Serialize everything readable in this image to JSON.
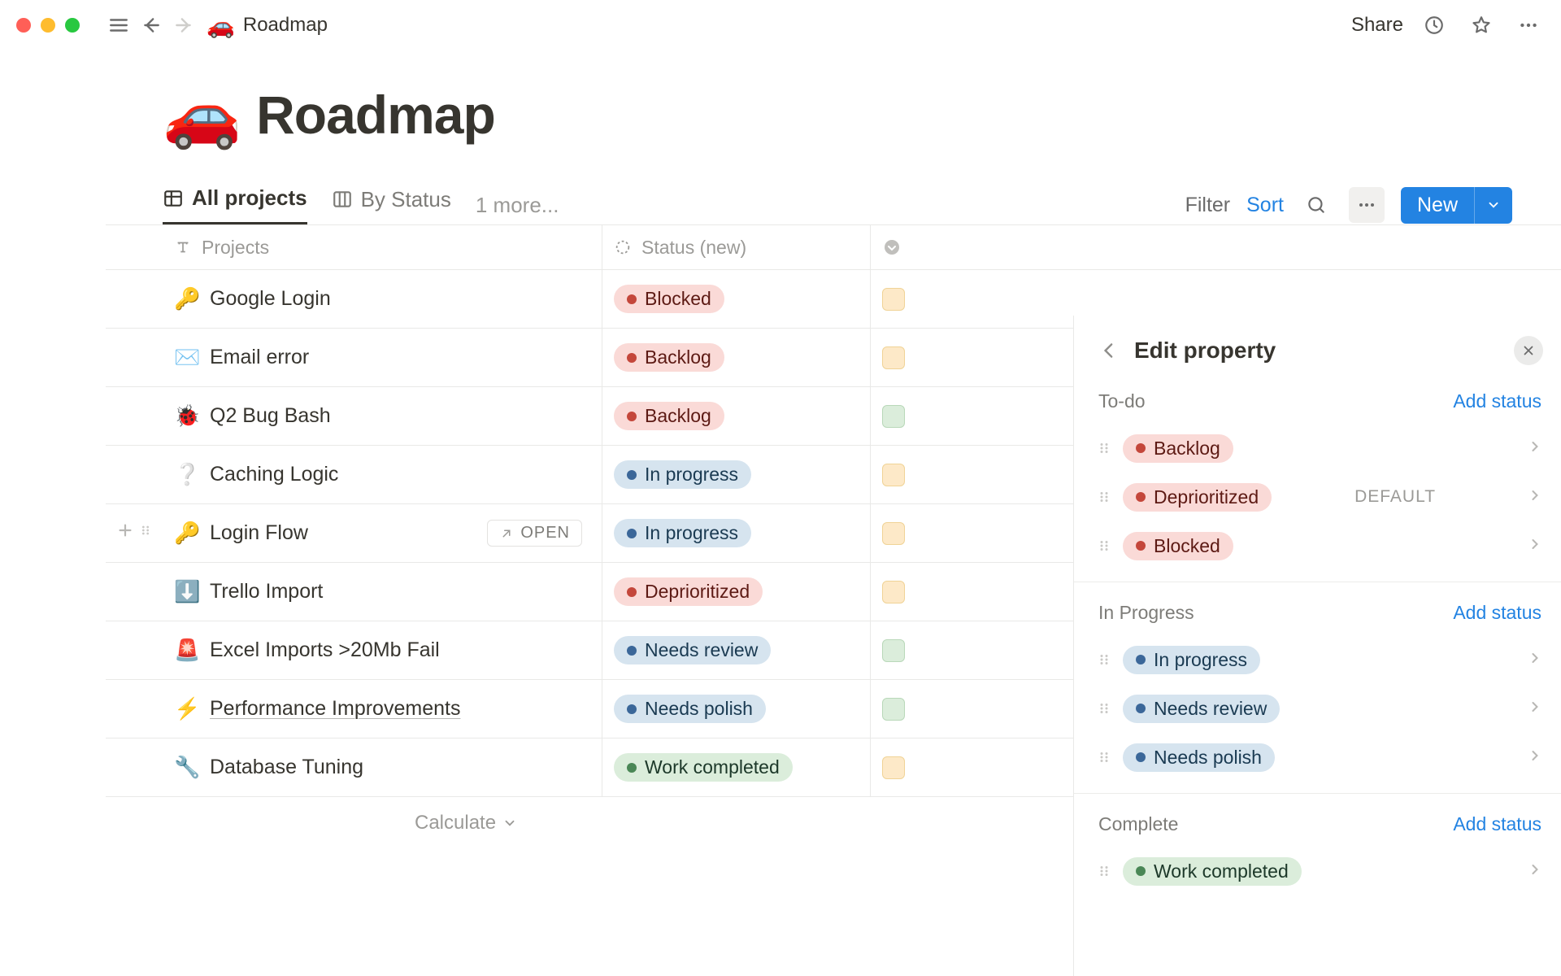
{
  "topbar": {
    "breadcrumb_emoji": "🚗",
    "breadcrumb_title": "Roadmap",
    "share_label": "Share"
  },
  "page": {
    "emoji": "🚗",
    "title": "Roadmap"
  },
  "tabs": {
    "all_projects": "All projects",
    "by_status": "By Status",
    "more": "1 more..."
  },
  "toolbar": {
    "filter": "Filter",
    "sort": "Sort",
    "new": "New"
  },
  "columns": {
    "projects": "Projects",
    "status": "Status (new)"
  },
  "open_label": "OPEN",
  "calculate_label": "Calculate",
  "rows": [
    {
      "emoji": "🔑",
      "name": "Google Login",
      "status": "Blocked",
      "status_class": "pill-red",
      "underline": false,
      "extra": "orange"
    },
    {
      "emoji": "✉️",
      "name": "Email error",
      "status": "Backlog",
      "status_class": "pill-pink",
      "underline": false,
      "extra": "orange"
    },
    {
      "emoji": "🐞",
      "name": "Q2 Bug Bash",
      "status": "Backlog",
      "status_class": "pill-pink",
      "underline": false,
      "extra": "green"
    },
    {
      "emoji": "❔",
      "name": "Caching Logic",
      "status": "In progress",
      "status_class": "pill-blue",
      "underline": false,
      "extra": "orange"
    },
    {
      "emoji": "🔑",
      "name": "Login Flow",
      "status": "In progress",
      "status_class": "pill-blue",
      "underline": false,
      "extra": "orange",
      "hovered": true
    },
    {
      "emoji": "⬇️",
      "name": "Trello Import",
      "status": "Deprioritized",
      "status_class": "pill-pink",
      "underline": false,
      "extra": "orange"
    },
    {
      "emoji": "🚨",
      "name": "Excel Imports >20Mb Fail",
      "status": "Needs review",
      "status_class": "pill-blue",
      "underline": false,
      "extra": "green"
    },
    {
      "emoji": "⚡",
      "name": "Performance Improvements",
      "status": "Needs polish",
      "status_class": "pill-blue",
      "underline": true,
      "extra": "green"
    },
    {
      "emoji": "🔧",
      "name": "Database Tuning",
      "status": "Work completed",
      "status_class": "pill-green",
      "underline": false,
      "extra": "orange"
    }
  ],
  "panel": {
    "title": "Edit property",
    "add_status": "Add status",
    "default_label": "DEFAULT",
    "groups": [
      {
        "title": "To-do",
        "items": [
          {
            "label": "Backlog",
            "class": "pill-pink"
          },
          {
            "label": "Deprioritized",
            "class": "pill-pink",
            "default": true
          },
          {
            "label": "Blocked",
            "class": "pill-red"
          }
        ]
      },
      {
        "title": "In Progress",
        "items": [
          {
            "label": "In progress",
            "class": "pill-blue"
          },
          {
            "label": "Needs review",
            "class": "pill-blue"
          },
          {
            "label": "Needs polish",
            "class": "pill-blue"
          }
        ]
      },
      {
        "title": "Complete",
        "items": [
          {
            "label": "Work completed",
            "class": "pill-green"
          }
        ]
      }
    ]
  }
}
